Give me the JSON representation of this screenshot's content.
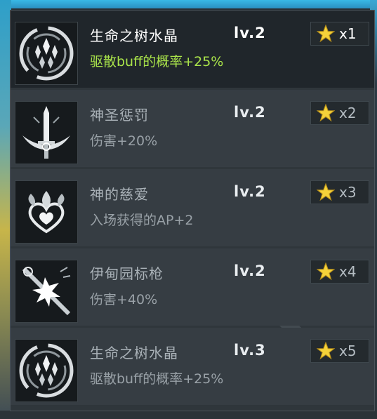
{
  "items": [
    {
      "name": "生命之树水晶",
      "level": "lv.2",
      "effect": "驱散buff的概率+25%",
      "count": "x1",
      "icon": "crystal-tree-icon",
      "active": true
    },
    {
      "name": "神圣惩罚",
      "level": "lv.2",
      "effect": "伤害+20%",
      "count": "x2",
      "icon": "holy-sword-icon",
      "active": false
    },
    {
      "name": "神的慈爱",
      "level": "lv.2",
      "effect": "入场获得的AP+2",
      "count": "x3",
      "icon": "heart-flame-icon",
      "active": false
    },
    {
      "name": "伊甸园标枪",
      "level": "lv.2",
      "effect": "伤害+40%",
      "count": "x4",
      "icon": "spear-burst-icon",
      "active": false
    },
    {
      "name": "生命之树水晶",
      "level": "lv.3",
      "effect": "驱散buff的概率+25%",
      "count": "x5",
      "icon": "crystal-tree-icon",
      "active": false
    }
  ],
  "colors": {
    "effect_active": "#a9e34a",
    "star": "#f5d23a",
    "panel": "#2f363b"
  }
}
